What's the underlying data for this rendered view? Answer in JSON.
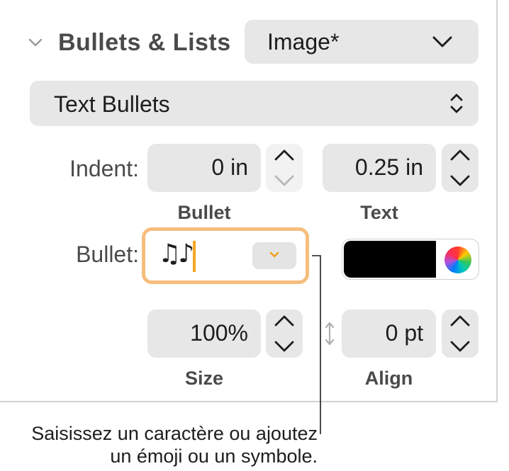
{
  "section": {
    "title": "Bullets & Lists",
    "preset_value": "Image*",
    "type_value": "Text Bullets"
  },
  "indent": {
    "label": "Indent:",
    "bullet_value": "0 in",
    "text_value": "0.25 in",
    "bullet_caption": "Bullet",
    "text_caption": "Text"
  },
  "bullet": {
    "label": "Bullet:",
    "value": "♫♪",
    "color": "#000000"
  },
  "size_align": {
    "size_value": "100%",
    "size_caption": "Size",
    "align_value": "0 pt",
    "align_caption": "Align"
  },
  "callout": {
    "line1": "Saisissez un caractère ou ajoutez",
    "line2": "un émoji ou un symbole."
  },
  "colors": {
    "focus_ring": "#f6bd7d",
    "caret": "#f5a623",
    "accent_chevron": "#f0a020"
  }
}
